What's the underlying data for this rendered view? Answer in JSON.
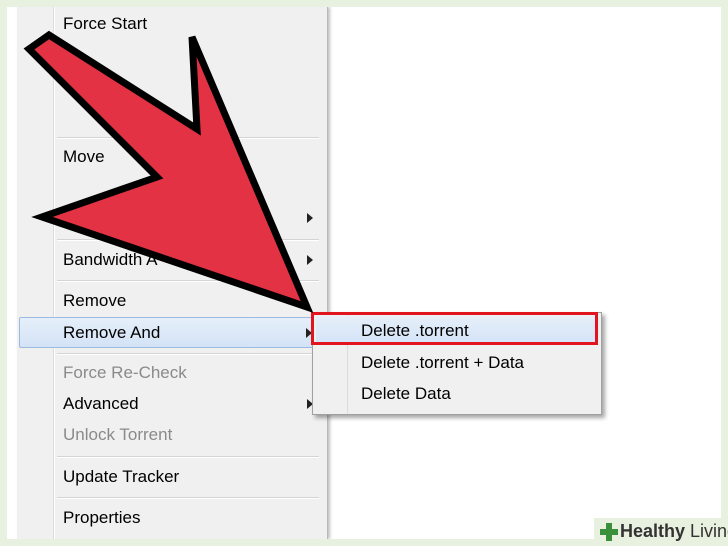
{
  "menu": {
    "items": [
      {
        "label": "Force Start",
        "disabled": false
      },
      {
        "label": "Move",
        "disabled": false
      },
      {
        "label": "Bandwidth A",
        "disabled": false
      },
      {
        "label": "Remove",
        "disabled": false
      },
      {
        "label": "Remove And",
        "disabled": false
      },
      {
        "label": "Force Re-Check",
        "disabled": true
      },
      {
        "label": "Advanced",
        "disabled": false
      },
      {
        "label": "Unlock Torrent",
        "disabled": true
      },
      {
        "label": "Update Tracker",
        "disabled": false
      },
      {
        "label": "Properties",
        "disabled": false
      }
    ]
  },
  "submenu": {
    "items": [
      {
        "label": "Delete .torrent"
      },
      {
        "label": "Delete .torrent + Data"
      },
      {
        "label": "Delete Data"
      }
    ]
  },
  "watermark": {
    "brand_bold": "Healthy",
    "brand_rest": " Living"
  },
  "colors": {
    "arrow_fill": "#e23244",
    "highlight_box": "#e2141f",
    "frame": "#e8f0df"
  }
}
